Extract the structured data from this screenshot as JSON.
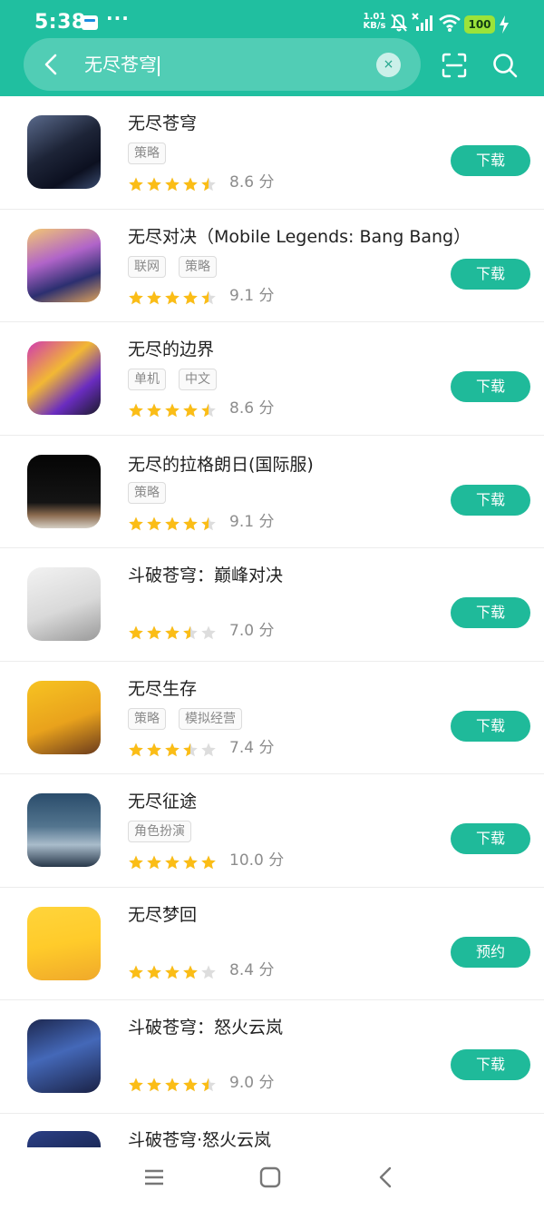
{
  "status_bar": {
    "time": "5:38",
    "net_speed_value": "1.01",
    "net_speed_unit": "KB/s",
    "battery": "100",
    "more_dots": "···"
  },
  "search": {
    "query": "无尽苍穹",
    "clear_symbol": "×"
  },
  "apps": [
    {
      "name": "无尽苍穹",
      "tags": [
        "策略"
      ],
      "rating": 4.5,
      "score": "8.6 分",
      "button": "下载"
    },
    {
      "name": "无尽对决（Mobile Legends: Bang Bang）",
      "tags": [
        "联网",
        "策略"
      ],
      "rating": 4.5,
      "score": "9.1 分",
      "button": "下载"
    },
    {
      "name": "无尽的边界",
      "tags": [
        "单机",
        "中文"
      ],
      "rating": 4.5,
      "score": "8.6 分",
      "button": "下载"
    },
    {
      "name": "无尽的拉格朗日(国际服)",
      "tags": [
        "策略"
      ],
      "rating": 4.5,
      "score": "9.1 分",
      "button": "下载"
    },
    {
      "name": "斗破苍穹：巅峰对决",
      "tags": [],
      "rating": 3.5,
      "score": "7.0 分",
      "button": "下载"
    },
    {
      "name": "无尽生存",
      "tags": [
        "策略",
        "模拟经营"
      ],
      "rating": 3.5,
      "score": "7.4 分",
      "button": "下载"
    },
    {
      "name": "无尽征途",
      "tags": [
        "角色扮演"
      ],
      "rating": 5,
      "score": "10.0 分",
      "button": "下载"
    },
    {
      "name": "无尽梦回",
      "tags": [],
      "rating": 4,
      "score": "8.4 分",
      "button": "预约"
    },
    {
      "name": "斗破苍穹：怒火云岚",
      "tags": [],
      "rating": 4.5,
      "score": "9.0 分",
      "button": "下载"
    },
    {
      "name": "斗破苍穹·怒火云岚"
    }
  ],
  "colors": {
    "header_green": "#20bfa0",
    "button_green": "#1fba9a",
    "star_gold": "#fbbd16",
    "star_empty": "#dddddd"
  },
  "icons": {
    "back": "back-arrow-icon",
    "clear": "clear-icon",
    "scan": "scan-icon",
    "search": "search-icon",
    "nav_menu": "menu-icon",
    "nav_home": "home-icon",
    "nav_back": "back-icon"
  }
}
